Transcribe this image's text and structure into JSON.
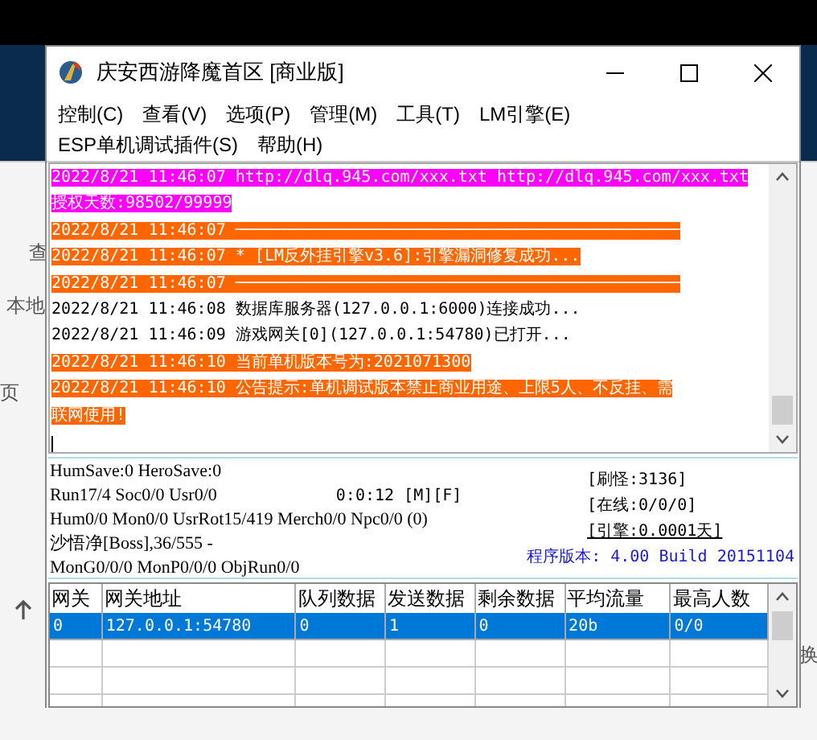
{
  "background": [
    "查",
    "本地",
    "页",
    "换"
  ],
  "window": {
    "title": "庆安西游降魔首区 [商业版]"
  },
  "menu": [
    "控制(C)",
    "查看(V)",
    "选项(P)",
    "管理(M)",
    "工具(T)",
    "LM引擎(E)",
    "ESP单机调试插件(S)",
    "帮助(H)"
  ],
  "log": [
    {
      "text": "2022/8/21 11:46:07 http://dlq.945.com/xxx.txt http://dlq.945.com/xxx.txt",
      "color": "#ff00ff"
    },
    {
      "text": "授权天数:98502/99999",
      "color": "#ff00ff"
    },
    {
      "text": "2022/8/21 11:46:07 ──────────────────────────────────────────────",
      "color": "#ff6600"
    },
    {
      "text": "2022/8/21 11:46:07 * [LM反外挂引擎v3.6]:引擎漏洞修复成功...",
      "color": "#ff6600"
    },
    {
      "text": "2022/8/21 11:46:07 ──────────────────────────────────────────────",
      "color": "#ff6600"
    },
    {
      "text": "2022/8/21 11:46:08 数据库服务器(127.0.0.1:6000)连接成功..."
    },
    {
      "text": "2022/8/21 11:46:09 游戏网关[0](127.0.0.1:54780)已打开..."
    },
    {
      "text": "2022/8/21 11:46:10 当前单机版本号为:2021071300",
      "color": "#ff6600"
    },
    {
      "text": "2022/8/21 11:46:10 公告提示:单机调试版本禁止商业用途、上限5人、不反挂、需",
      "color": "#ff6600"
    },
    {
      "text": "联网使用!",
      "color": "#ff6600"
    }
  ],
  "status": {
    "lines": [
      "HumSave:0 HeroSave:0",
      "Run17/4 Soc0/0 Usr0/0",
      "Hum0/0 Mon0/0 UsrRot15/419 Merch0/0 Npc0/0 (0)",
      "沙悟净[Boss],36/555 -",
      "MonG0/0/0 MonP0/0/0 ObjRun0/0"
    ],
    "timer": "0:0:12 [M][F]",
    "counters": [
      {
        "text": "[刷怪:3136]",
        "underlined": false
      },
      {
        "text": "[在线:0/0/0]",
        "underlined": false
      },
      {
        "text": "[引擎:0.0001天]",
        "underlined": true
      }
    ],
    "version": "程序版本: 4.00 Build 20151104"
  },
  "table": {
    "columns": [
      "网关",
      "网关地址",
      "队列数据",
      "发送数据",
      "剩余数据",
      "平均流量",
      "最高人数"
    ],
    "rows": [
      {
        "cells": [
          "0",
          "127.0.0.1:54780",
          "0",
          "1",
          "0",
          "20b",
          "0/0"
        ],
        "selected": true
      }
    ]
  }
}
